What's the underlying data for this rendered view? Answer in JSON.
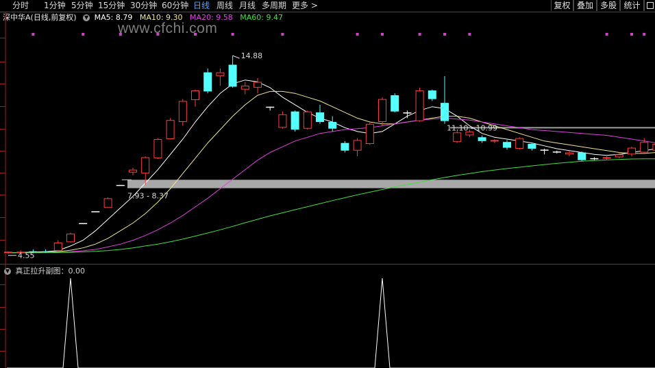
{
  "toolbar": {
    "tabs": [
      "分时",
      "1分钟",
      "5分钟",
      "15分钟",
      "30分钟",
      "60分钟",
      "日线",
      "周线",
      "月线",
      "多周期",
      "更多 >"
    ],
    "active_tab": "日线",
    "right_buttons": [
      "复权",
      "叠加",
      "多股",
      "统计"
    ]
  },
  "main": {
    "title": "深中华A(日线,前复权)",
    "ma_labels": [
      {
        "text": "MA5: 8.79",
        "color": "#ffffff"
      },
      {
        "text": "MA10: 9.30",
        "color": "#f0e68c"
      },
      {
        "text": "MA20: 9.58",
        "color": "#e040e0"
      },
      {
        "text": "MA60: 9.47",
        "color": "#40e040"
      }
    ],
    "annotations": {
      "high": "14.88",
      "range1": "7.93 - 8.37",
      "range2": "11.10 - 10.99",
      "low": "4.55"
    }
  },
  "watermark": "www.cfchi.com",
  "sub": {
    "label": "真正拉升副图：0.00"
  },
  "chart_data": {
    "type": "candlestick",
    "ylim": [
      4.0,
      16.5
    ],
    "candles": [
      {
        "o": 4.55,
        "h": 4.62,
        "l": 4.5,
        "c": 4.6,
        "dir": "up"
      },
      {
        "o": 4.6,
        "h": 4.66,
        "l": 4.55,
        "c": 4.6,
        "dir": "up"
      },
      {
        "o": 4.62,
        "h": 4.72,
        "l": 4.56,
        "c": 4.58,
        "dir": "down"
      },
      {
        "o": 4.6,
        "h": 4.72,
        "l": 4.55,
        "c": 4.62,
        "dir": "down"
      },
      {
        "o": 4.65,
        "h": 5.2,
        "l": 4.62,
        "c": 5.08,
        "dir": "up"
      },
      {
        "o": 5.1,
        "h": 5.6,
        "l": 5.08,
        "c": 5.55,
        "dir": "up"
      },
      {
        "o": 6.1,
        "h": 6.1,
        "l": 6.1,
        "c": 6.1,
        "dir": "flat"
      },
      {
        "o": 6.72,
        "h": 6.72,
        "l": 6.72,
        "c": 6.72,
        "dir": "flat"
      },
      {
        "o": 6.9,
        "h": 7.45,
        "l": 6.9,
        "c": 7.4,
        "dir": "up"
      },
      {
        "o": 8.1,
        "h": 8.1,
        "l": 8.1,
        "c": 8.1,
        "dir": "flat"
      },
      {
        "o": 8.75,
        "h": 9.0,
        "l": 8.6,
        "c": 8.9,
        "dir": "up"
      },
      {
        "o": 8.7,
        "h": 9.6,
        "l": 8.1,
        "c": 9.55,
        "dir": "up"
      },
      {
        "o": 9.5,
        "h": 10.55,
        "l": 9.45,
        "c": 10.5,
        "dir": "up"
      },
      {
        "o": 10.5,
        "h": 11.6,
        "l": 10.5,
        "c": 11.5,
        "dir": "up"
      },
      {
        "o": 11.4,
        "h": 12.6,
        "l": 11.2,
        "c": 12.5,
        "dir": "up"
      },
      {
        "o": 12.55,
        "h": 13.1,
        "l": 12.2,
        "c": 13.05,
        "dir": "up"
      },
      {
        "o": 13.0,
        "h": 14.2,
        "l": 12.9,
        "c": 14.0,
        "dir": "down"
      },
      {
        "o": 13.8,
        "h": 14.2,
        "l": 13.3,
        "c": 14.0,
        "dir": "up"
      },
      {
        "o": 13.25,
        "h": 14.88,
        "l": 13.2,
        "c": 14.4,
        "dir": "down"
      },
      {
        "o": 13.3,
        "h": 13.5,
        "l": 12.85,
        "c": 13.1,
        "dir": "up"
      },
      {
        "o": 13.2,
        "h": 13.7,
        "l": 12.9,
        "c": 13.5,
        "dir": "up"
      },
      {
        "o": 12.2,
        "h": 12.2,
        "l": 12.0,
        "c": 12.2,
        "dir": "flat"
      },
      {
        "o": 11.1,
        "h": 11.95,
        "l": 11.05,
        "c": 11.8,
        "dir": "up"
      },
      {
        "o": 11.95,
        "h": 12.0,
        "l": 10.9,
        "c": 11.0,
        "dir": "down"
      },
      {
        "o": 11.05,
        "h": 12.0,
        "l": 11.0,
        "c": 11.95,
        "dir": "up"
      },
      {
        "o": 11.9,
        "h": 12.3,
        "l": 11.3,
        "c": 11.4,
        "dir": "down"
      },
      {
        "o": 11.4,
        "h": 11.7,
        "l": 10.9,
        "c": 11.05,
        "dir": "down"
      },
      {
        "o": 10.3,
        "h": 10.4,
        "l": 9.8,
        "c": 9.9,
        "dir": "down"
      },
      {
        "o": 9.9,
        "h": 10.55,
        "l": 9.6,
        "c": 10.45,
        "dir": "up"
      },
      {
        "o": 10.25,
        "h": 11.4,
        "l": 10.2,
        "c": 11.3,
        "dir": "up"
      },
      {
        "o": 11.4,
        "h": 12.7,
        "l": 11.2,
        "c": 12.6,
        "dir": "up"
      },
      {
        "o": 12.8,
        "h": 12.9,
        "l": 11.9,
        "c": 11.95,
        "dir": "down"
      },
      {
        "o": 11.8,
        "h": 12.0,
        "l": 11.6,
        "c": 11.9,
        "dir": "flat"
      },
      {
        "o": 11.45,
        "h": 13.2,
        "l": 11.4,
        "c": 13.05,
        "dir": "up"
      },
      {
        "o": 13.05,
        "h": 13.1,
        "l": 12.5,
        "c": 12.6,
        "dir": "down"
      },
      {
        "o": 12.4,
        "h": 13.8,
        "l": 11.3,
        "c": 11.45,
        "dir": "down"
      },
      {
        "o": 10.35,
        "h": 11.0,
        "l": 10.3,
        "c": 10.85,
        "dir": "up"
      },
      {
        "o": 10.7,
        "h": 11.0,
        "l": 10.6,
        "c": 10.9,
        "dir": "up"
      },
      {
        "o": 10.6,
        "h": 10.7,
        "l": 10.3,
        "c": 10.4,
        "dir": "down"
      },
      {
        "o": 10.45,
        "h": 10.5,
        "l": 10.3,
        "c": 10.4,
        "dir": "up"
      },
      {
        "o": 10.35,
        "h": 10.45,
        "l": 9.95,
        "c": 10.05,
        "dir": "down"
      },
      {
        "o": 10.0,
        "h": 10.6,
        "l": 9.95,
        "c": 10.55,
        "dir": "up"
      },
      {
        "o": 10.25,
        "h": 10.3,
        "l": 9.9,
        "c": 10.0,
        "dir": "down"
      },
      {
        "o": 9.95,
        "h": 10.0,
        "l": 9.7,
        "c": 9.9,
        "dir": "flat"
      },
      {
        "o": 9.85,
        "h": 9.9,
        "l": 9.75,
        "c": 9.85,
        "dir": "flat"
      },
      {
        "o": 9.8,
        "h": 9.9,
        "l": 9.6,
        "c": 9.7,
        "dir": "up"
      },
      {
        "o": 9.8,
        "h": 9.85,
        "l": 9.35,
        "c": 9.4,
        "dir": "down"
      },
      {
        "o": 9.5,
        "h": 9.55,
        "l": 9.4,
        "c": 9.5,
        "dir": "flat"
      },
      {
        "o": 9.5,
        "h": 9.6,
        "l": 9.4,
        "c": 9.55,
        "dir": "up"
      },
      {
        "o": 9.55,
        "h": 9.8,
        "l": 9.5,
        "c": 9.7,
        "dir": "up"
      },
      {
        "o": 9.7,
        "h": 10.1,
        "l": 9.6,
        "c": 10.05,
        "dir": "up"
      },
      {
        "o": 9.8,
        "h": 10.55,
        "l": 9.75,
        "c": 10.35,
        "dir": "up"
      },
      {
        "o": 9.9,
        "h": 10.4,
        "l": 9.8,
        "c": 10.25,
        "dir": "up"
      }
    ],
    "series": [
      {
        "name": "MA5",
        "color": "#ffffff",
        "values": [
          4.55,
          4.56,
          4.58,
          4.6,
          4.66,
          4.9,
          5.2,
          5.7,
          6.3,
          6.9,
          7.5,
          8.2,
          8.9,
          9.7,
          10.5,
          11.4,
          12.2,
          12.9,
          13.4,
          13.6,
          13.5,
          13.2,
          12.7,
          12.3,
          11.9,
          11.6,
          11.4,
          11.1,
          10.9,
          10.8,
          10.9,
          11.3,
          11.7,
          12.0,
          12.2,
          12.1,
          11.7,
          11.2,
          10.8,
          10.6,
          10.5,
          10.4,
          10.3,
          10.15,
          10.0,
          9.9,
          9.8,
          9.7,
          9.65,
          9.7,
          9.8,
          9.9,
          10.0
        ]
      },
      {
        "name": "MA10",
        "color": "#f0e68c",
        "values": [
          4.55,
          4.55,
          4.56,
          4.57,
          4.6,
          4.68,
          4.8,
          5.0,
          5.3,
          5.7,
          6.1,
          6.6,
          7.2,
          7.9,
          8.7,
          9.5,
          10.3,
          11.0,
          11.7,
          12.3,
          12.8,
          13.0,
          13.0,
          12.9,
          12.7,
          12.5,
          12.2,
          11.9,
          11.6,
          11.4,
          11.3,
          11.3,
          11.4,
          11.5,
          11.6,
          11.7,
          11.7,
          11.6,
          11.4,
          11.2,
          11.0,
          10.8,
          10.6,
          10.4,
          10.3,
          10.2,
          10.1,
          10.0,
          9.9,
          9.8,
          9.75,
          9.75,
          9.8
        ]
      },
      {
        "name": "MA20",
        "color": "#e040e0",
        "values": [
          4.55,
          4.55,
          4.55,
          4.56,
          4.57,
          4.6,
          4.65,
          4.72,
          4.85,
          5.0,
          5.2,
          5.45,
          5.75,
          6.1,
          6.5,
          6.95,
          7.4,
          7.9,
          8.4,
          8.9,
          9.4,
          9.8,
          10.1,
          10.4,
          10.6,
          10.8,
          10.9,
          11.0,
          11.05,
          11.1,
          11.2,
          11.3,
          11.4,
          11.5,
          11.55,
          11.6,
          11.55,
          11.5,
          11.4,
          11.3,
          11.2,
          11.1,
          11.0,
          10.95,
          10.9,
          10.85,
          10.8,
          10.75,
          10.7,
          10.6,
          10.5,
          10.4,
          10.3
        ]
      },
      {
        "name": "MA60",
        "color": "#40e040",
        "values": [
          4.55,
          4.55,
          4.55,
          4.55,
          4.56,
          4.57,
          4.59,
          4.62,
          4.66,
          4.72,
          4.8,
          4.9,
          5.0,
          5.12,
          5.26,
          5.42,
          5.58,
          5.75,
          5.93,
          6.12,
          6.3,
          6.48,
          6.64,
          6.8,
          6.96,
          7.12,
          7.28,
          7.43,
          7.58,
          7.72,
          7.86,
          8.0,
          8.12,
          8.25,
          8.37,
          8.49,
          8.6,
          8.7,
          8.8,
          8.88,
          8.96,
          9.03,
          9.1,
          9.17,
          9.23,
          9.29,
          9.34,
          9.38,
          9.41,
          9.44,
          9.46,
          9.47,
          9.47
        ]
      }
    ],
    "sub_series": {
      "name": "真正拉升",
      "ylim": [
        0,
        1
      ],
      "spikes": [
        5,
        30
      ]
    },
    "highlights": [
      {
        "label": "7.93 - 8.37",
        "low": 7.93,
        "high": 8.37
      },
      {
        "label": "11.10 - 10.99",
        "low": 10.99,
        "high": 11.1
      }
    ],
    "flags": [
      2,
      6,
      9,
      12,
      15,
      18,
      22,
      28,
      30,
      33,
      35,
      37,
      48,
      50,
      51
    ]
  }
}
